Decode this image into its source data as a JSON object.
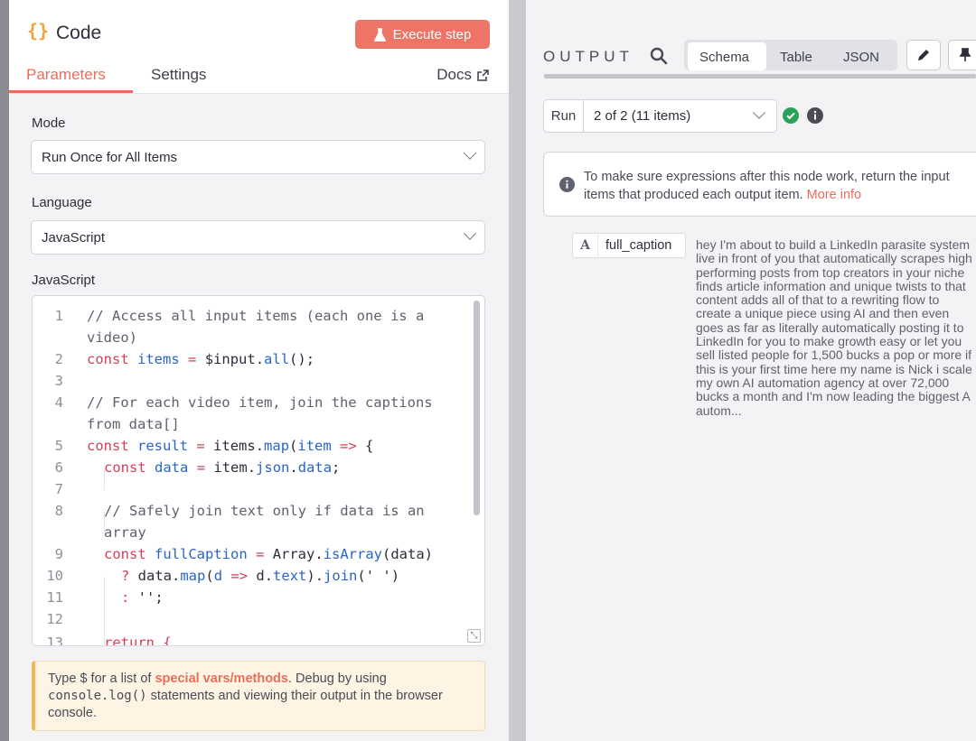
{
  "node": {
    "icon": "{}",
    "title": "Code",
    "execute_label": "Execute step"
  },
  "tabs": {
    "parameters": "Parameters",
    "settings": "Settings",
    "docs": "Docs"
  },
  "params": {
    "mode_label": "Mode",
    "mode_value": "Run Once for All Items",
    "language_label": "Language",
    "language_value": "JavaScript",
    "code_label": "JavaScript"
  },
  "code_lines": [
    {
      "n": "1",
      "text": "// Access all input items (each one is a video)"
    },
    {
      "n": "2",
      "text": "const items = $input.all();"
    },
    {
      "n": "3",
      "text": ""
    },
    {
      "n": "4",
      "text": "// For each video item, join the captions from data[]"
    },
    {
      "n": "5",
      "text": "const result = items.map(item => {"
    },
    {
      "n": "6",
      "text": "const data = item.json.data;"
    },
    {
      "n": "7",
      "text": ""
    },
    {
      "n": "8",
      "text": "// Safely join text only if data is an array"
    },
    {
      "n": "9",
      "text": "const fullCaption = Array.isArray(data)"
    },
    {
      "n": "10",
      "text": "? data.map(d => d.text).join(' ')"
    },
    {
      "n": "11",
      "text": ": '';"
    },
    {
      "n": "12",
      "text": ""
    },
    {
      "n": "13",
      "text": "return {"
    }
  ],
  "hint": {
    "pre": "Type $ for a list of ",
    "link": "special vars/methods",
    "mid": ". Debug by using ",
    "code": "console.log()",
    "post": " statements and viewing their output in the browser console."
  },
  "output": {
    "title": "OUTPUT",
    "view_tabs": [
      "Schema",
      "Table",
      "JSON"
    ],
    "active_tab": "Schema",
    "run_label": "Run",
    "run_value": "2 of 2 (11 items)",
    "notice_text": "To make sure expressions after this node work, return the input items that produced each output item.",
    "notice_link": "More info",
    "field_type": "A",
    "field_name": "full_caption",
    "field_value": "hey I'm about to build a LinkedIn parasite system live in front of you that automatically scrapes high performing posts from top creators in your niche finds article information and unique twists to that content adds all of that to a rewriting flow to create a unique piece using AI and then even goes as far as literally automatically posting it to LinkedIn for you to make growth easy or let you sell listed people for 1,500 bucks a pop or more if this is your first time here my name is Nick i scale my own AI automation agency at over 72,000 bucks a month and I'm now leading the biggest A autom..."
  },
  "colors": {
    "accent": "#ea6d5c",
    "execute_bg": "#ee7467",
    "success": "#29a35a"
  }
}
